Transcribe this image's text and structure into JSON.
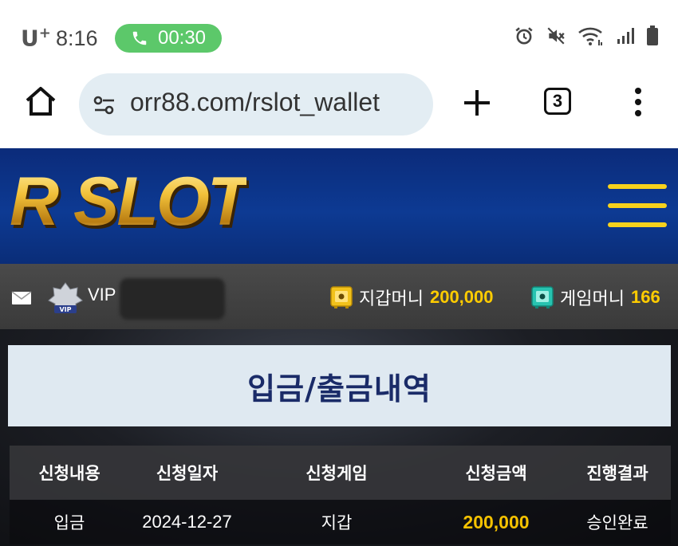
{
  "status_bar": {
    "carrier": "U",
    "carrier_plus": "+",
    "time": "8:16",
    "call_timer": "00:30"
  },
  "browser": {
    "url": "orr88.com/rslot_wallet",
    "tab_count": "3"
  },
  "site": {
    "logo_text": "R SLOT"
  },
  "user": {
    "level": "VIP",
    "wallet_money_label": "지갑머니",
    "wallet_money_value": "200,000",
    "game_money_label": "게임머니",
    "game_money_value": "166"
  },
  "page": {
    "title": "입금/출금내역"
  },
  "table": {
    "headers": [
      "신청내용",
      "신청일자",
      "신청게임",
      "신청금액",
      "진행결과"
    ],
    "rows": [
      [
        "입금",
        "2024-12-27",
        "지갑",
        "200,000",
        "승인완료"
      ]
    ]
  },
  "colors": {
    "call_pill": "#5cc86a",
    "header_blue": "#0d3a93",
    "gold": "#f5c200",
    "title_text": "#1a2b68"
  }
}
